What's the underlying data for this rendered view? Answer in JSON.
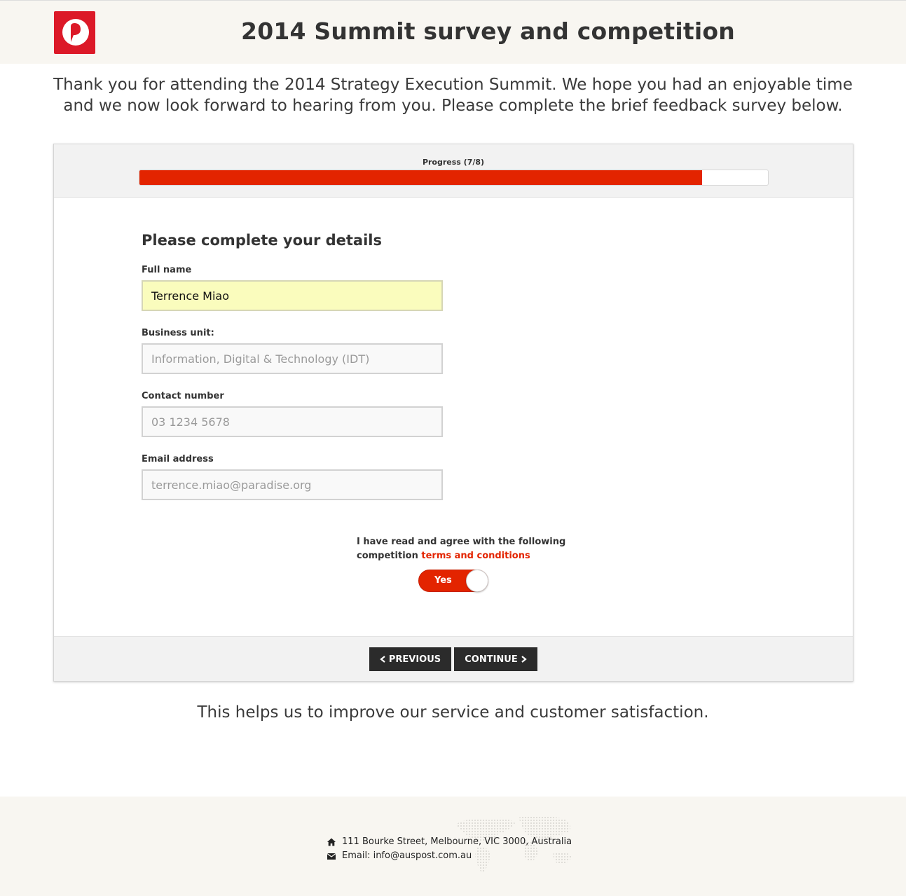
{
  "header": {
    "title": "2014 Summit survey and competition",
    "logo_icon": "auspost-logo-icon",
    "brand_color": "#dc1928"
  },
  "intro": {
    "text": "Thank you for attending the 2014 Strategy Execution Summit. We hope you had an enjoyable time and we now look forward to hearing from you. Please complete the brief feedback survey below."
  },
  "progress": {
    "label": "Progress (7/8)",
    "current": 7,
    "total": 8,
    "fraction": 0.895,
    "color": "#e32400"
  },
  "form": {
    "title": "Please complete your details",
    "fields": [
      {
        "label": "Full name",
        "value": "Terrence Miao",
        "placeholder": ""
      },
      {
        "label": "Business unit:",
        "value": "",
        "placeholder": "Information, Digital & Technology (IDT)"
      },
      {
        "label": "Contact number",
        "value": "",
        "placeholder": "03 1234 5678"
      },
      {
        "label": "Email address",
        "value": "",
        "placeholder": "terrence.miao@paradise.org"
      }
    ],
    "agreement": {
      "text": "I have read and agree with the following competition",
      "link_text": "terms and conditions",
      "toggle_label": "Yes",
      "toggle_on": true
    }
  },
  "buttons": {
    "previous": "PREVIOUS",
    "previous_icon": "chevron-left-icon",
    "continue": "CONTINUE",
    "continue_icon": "chevron-right-icon"
  },
  "bottom_note": "This helps us to improve our service and customer satisfaction.",
  "footer": {
    "address": "111 Bourke Street, Melbourne, VIC 3000, Australia",
    "address_icon": "home-icon",
    "email": "Email: info@auspost.com.au",
    "email_icon": "envelope-icon",
    "background_icon": "world-map-icon"
  }
}
